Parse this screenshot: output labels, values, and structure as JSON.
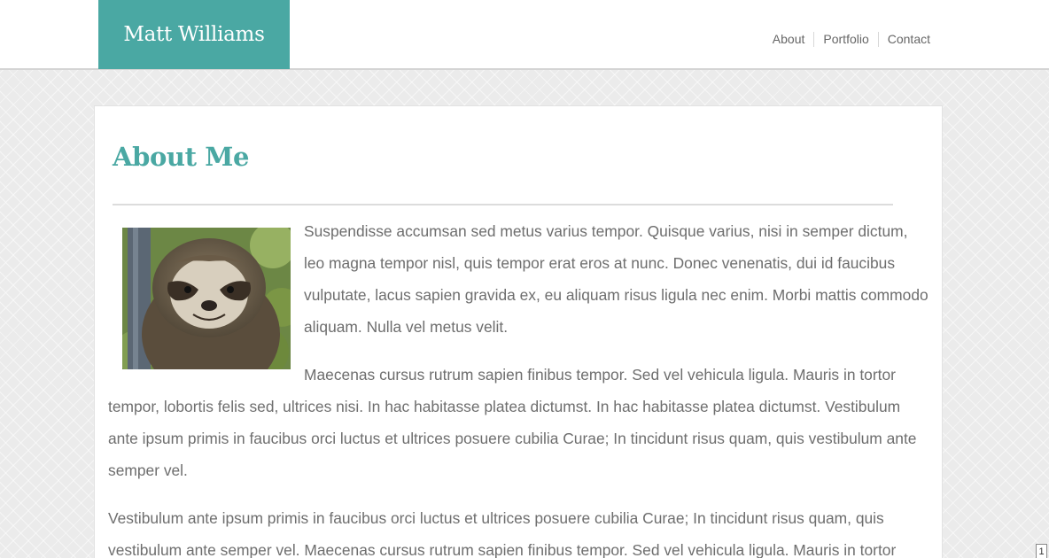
{
  "site": {
    "brand": "Matt Williams",
    "brand_color": "#4aa8a3"
  },
  "nav": {
    "items": [
      {
        "label": "About"
      },
      {
        "label": "Portfolio"
      },
      {
        "label": "Contact"
      }
    ]
  },
  "main": {
    "title": "About Me",
    "photo": {
      "icon": "sloth-photo"
    },
    "paragraphs": [
      "Suspendisse accumsan sed metus varius tempor. Quisque varius, nisi in semper dictum, leo magna tempor nisl, quis tempor erat eros at nunc. Donec venenatis, dui id faucibus vulputate, lacus sapien gravida ex, eu aliquam risus ligula nec enim. Morbi mattis commodo aliquam. Nulla vel metus velit.",
      "Maecenas cursus rutrum sapien finibus tempor. Sed vel vehicula ligula. Mauris in tortor tempor, lobortis felis sed, ultrices nisi. In hac habitasse platea dictumst. In hac habitasse platea dictumst. Vestibulum ante ipsum primis in faucibus orci luctus et ultrices posuere cubilia Curae; In tincidunt risus quam, quis vestibulum ante semper vel.",
      "Vestibulum ante ipsum primis in faucibus orci luctus et ultrices posuere cubilia Curae; In tincidunt risus quam, quis vestibulum ante semper vel. Maecenas cursus rutrum sapien finibus tempor. Sed vel vehicula ligula. Mauris in tortor"
    ]
  },
  "page_badge": "1"
}
